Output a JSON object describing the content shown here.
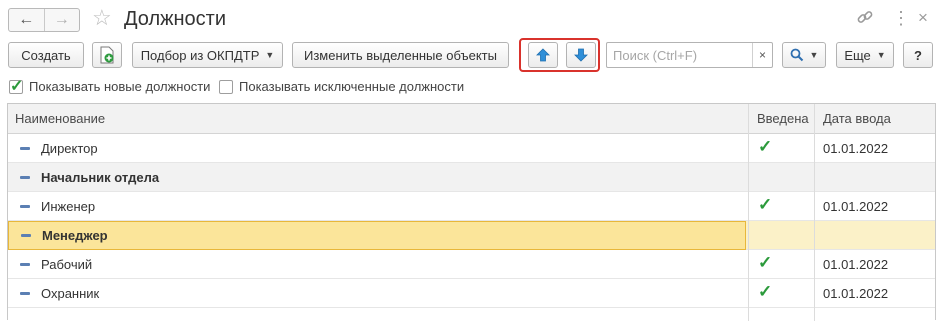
{
  "window": {
    "title": "Должности"
  },
  "toolbar": {
    "create_label": "Создать",
    "okpdtr_label": "Подбор из ОКПДТР",
    "edit_selected_label": "Изменить выделенные объекты",
    "search_placeholder": "Поиск (Ctrl+F)",
    "clear_label": "×",
    "more_label": "Еще",
    "help_label": "?"
  },
  "filters": {
    "show_new_label": "Показывать новые должности",
    "show_new_checked": true,
    "show_excluded_label": "Показывать исключенные должности",
    "show_excluded_checked": false
  },
  "table": {
    "columns": [
      "Наименование",
      "Введена",
      "Дата ввода"
    ],
    "rows": [
      {
        "name": "Директор",
        "introduced": true,
        "date": "01.01.2022",
        "group": false,
        "selected": false
      },
      {
        "name": "Начальник отдела",
        "introduced": false,
        "date": "",
        "group": true,
        "selected": false
      },
      {
        "name": "Инженер",
        "introduced": true,
        "date": "01.01.2022",
        "group": false,
        "selected": false
      },
      {
        "name": "Менеджер",
        "introduced": false,
        "date": "",
        "group": true,
        "selected": true
      },
      {
        "name": "Рабочий",
        "introduced": true,
        "date": "01.01.2022",
        "group": false,
        "selected": false
      },
      {
        "name": "Охранник",
        "introduced": true,
        "date": "01.01.2022",
        "group": false,
        "selected": false
      }
    ]
  },
  "colors": {
    "highlight_frame": "#d9322c",
    "checkmark": "#2b9a3b",
    "move_arrow": "#2f8fd8",
    "selected_row": "#fbe59a"
  },
  "icons": [
    "back-arrow-icon",
    "forward-arrow-icon",
    "favorite-star-icon",
    "link-icon",
    "more-vertical-icon",
    "close-icon",
    "add-document-icon",
    "move-up-icon",
    "move-down-icon",
    "search-icon"
  ]
}
